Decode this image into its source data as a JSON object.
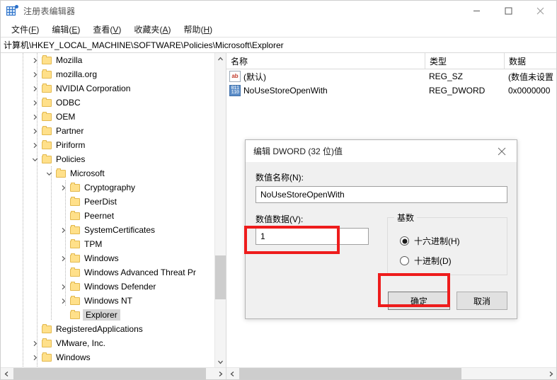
{
  "window": {
    "title": "注册表编辑器",
    "icon": "registry-editor-icon",
    "controls": {
      "minimize": "–",
      "maximize": "□",
      "close": "✕"
    }
  },
  "menubar": {
    "items": [
      {
        "label": "文件",
        "accel": "F"
      },
      {
        "label": "编辑",
        "accel": "E"
      },
      {
        "label": "查看",
        "accel": "V"
      },
      {
        "label": "收藏夹",
        "accel": "A"
      },
      {
        "label": "帮助",
        "accel": "H"
      }
    ]
  },
  "address": {
    "path": "计算机\\HKEY_LOCAL_MACHINE\\SOFTWARE\\Policies\\Microsoft\\Explorer"
  },
  "tree": {
    "items": [
      {
        "label": "Mozilla",
        "depth": 2,
        "expander": "collapsed",
        "selected": false
      },
      {
        "label": "mozilla.org",
        "depth": 2,
        "expander": "collapsed",
        "selected": false
      },
      {
        "label": "NVIDIA Corporation",
        "depth": 2,
        "expander": "collapsed",
        "selected": false
      },
      {
        "label": "ODBC",
        "depth": 2,
        "expander": "collapsed",
        "selected": false
      },
      {
        "label": "OEM",
        "depth": 2,
        "expander": "collapsed",
        "selected": false
      },
      {
        "label": "Partner",
        "depth": 2,
        "expander": "collapsed",
        "selected": false
      },
      {
        "label": "Piriform",
        "depth": 2,
        "expander": "collapsed",
        "selected": false
      },
      {
        "label": "Policies",
        "depth": 2,
        "expander": "expanded",
        "selected": false
      },
      {
        "label": "Microsoft",
        "depth": 3,
        "expander": "expanded",
        "selected": false
      },
      {
        "label": "Cryptography",
        "depth": 4,
        "expander": "collapsed",
        "selected": false
      },
      {
        "label": "PeerDist",
        "depth": 4,
        "expander": "none",
        "selected": false
      },
      {
        "label": "Peernet",
        "depth": 4,
        "expander": "none",
        "selected": false
      },
      {
        "label": "SystemCertificates",
        "depth": 4,
        "expander": "collapsed",
        "selected": false
      },
      {
        "label": "TPM",
        "depth": 4,
        "expander": "none",
        "selected": false
      },
      {
        "label": "Windows",
        "depth": 4,
        "expander": "collapsed",
        "selected": false
      },
      {
        "label": "Windows Advanced Threat Pr",
        "depth": 4,
        "expander": "none",
        "selected": false
      },
      {
        "label": "Windows Defender",
        "depth": 4,
        "expander": "collapsed",
        "selected": false
      },
      {
        "label": "Windows NT",
        "depth": 4,
        "expander": "collapsed",
        "selected": false
      },
      {
        "label": "Explorer",
        "depth": 4,
        "expander": "none",
        "selected": true
      },
      {
        "label": "RegisteredApplications",
        "depth": 2,
        "expander": "none",
        "selected": false
      },
      {
        "label": "VMware, Inc.",
        "depth": 2,
        "expander": "collapsed",
        "selected": false
      },
      {
        "label": "Windows",
        "depth": 2,
        "expander": "collapsed",
        "selected": false
      }
    ]
  },
  "list": {
    "columns": [
      "名称",
      "类型",
      "数据"
    ],
    "rows": [
      {
        "icon": "string-value-icon",
        "name": "(默认)",
        "type": "REG_SZ",
        "data": "(数值未设置"
      },
      {
        "icon": "dword-value-icon",
        "name": "NoUseStoreOpenWith",
        "type": "REG_DWORD",
        "data": "0x0000000"
      }
    ]
  },
  "dialog": {
    "title": "编辑 DWORD (32 位)值",
    "close": "✕",
    "value_name_label": "数值名称(N):",
    "value_name": "NoUseStoreOpenWith",
    "value_data_label": "数值数据(V):",
    "value_data": "1",
    "base_group_label": "基数",
    "radios": [
      {
        "label": "十六进制(H)",
        "selected": true
      },
      {
        "label": "十进制(D)",
        "selected": false
      }
    ],
    "ok_label": "确定",
    "cancel_label": "取消"
  },
  "annotations": {
    "color": "#ee1c1c",
    "boxes": [
      "value-data-input",
      "ok-button"
    ]
  }
}
